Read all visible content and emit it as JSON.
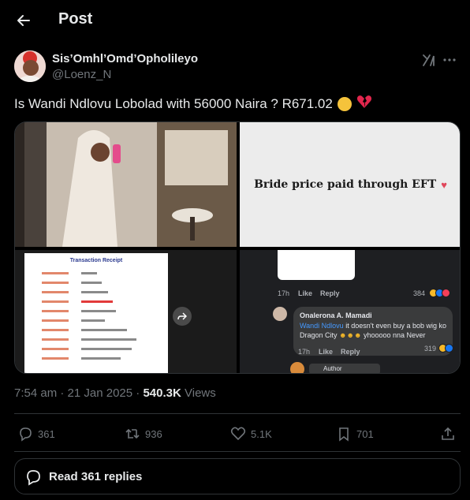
{
  "header": {
    "title": "Post"
  },
  "author": {
    "display_name": "Sis’Omhl’Omd’Opholileyo",
    "handle": "@Loenz_N"
  },
  "post": {
    "text": "Is Wandi Ndlovu Lobolad with 56000 Naira ? R671.02"
  },
  "media": {
    "tile2_text": "Bride price paid through EFT",
    "receipt_title": "Transaction Receipt",
    "fb": {
      "top_time": "17h",
      "top_like": "Like",
      "top_reply": "Reply",
      "top_count": "384",
      "commenter": "Onalerona A. Mamadi",
      "mention": "Wandi Ndlovu",
      "comment_text": " it doesn't even buy a bob wig ko Dragon City",
      "comment_tail": " yhooooo nna Never",
      "time": "17h",
      "like": "Like",
      "reply": "Reply",
      "count": "319",
      "author_chip": "Author"
    }
  },
  "meta": {
    "time": "7:54 am",
    "sep": " · ",
    "date": "21 Jan 2025",
    "views_count": "540.3K",
    "views_label": " Views"
  },
  "actions": {
    "replies": "361",
    "reposts": "936",
    "likes": "5.1K",
    "bookmarks": "701"
  },
  "read_replies": {
    "label": "Read 361 replies"
  },
  "colors": {
    "background": "#000000",
    "text": "#e7e9ea",
    "muted": "#71767b",
    "border": "#2f3336",
    "link": "#4599ff"
  },
  "icons": [
    "back-arrow-icon",
    "grok-icon",
    "more-icon",
    "reply-icon",
    "repost-icon",
    "like-icon",
    "bookmark-icon",
    "share-icon",
    "chat-bubble-icon"
  ]
}
